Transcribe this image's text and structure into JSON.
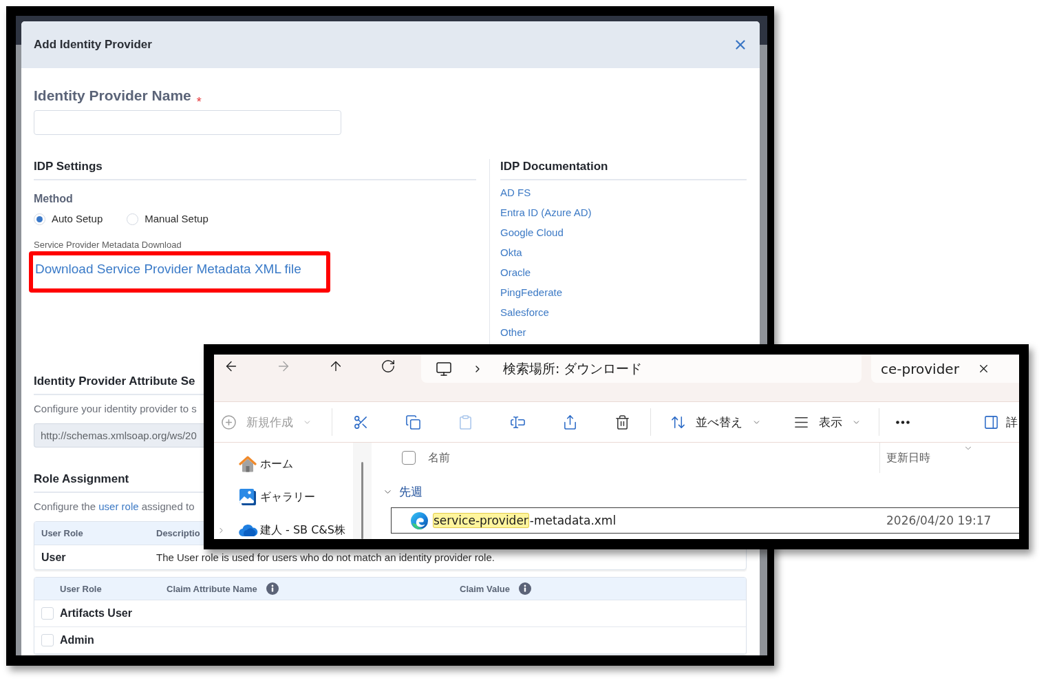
{
  "dialog": {
    "title": "Add Identity Provider"
  },
  "name_field": {
    "label": "Identity Provider Name",
    "required_mark": "*"
  },
  "idp_settings": {
    "heading": "IDP Settings",
    "method_label": "Method",
    "methods": [
      {
        "label": "Auto Setup",
        "selected": true
      },
      {
        "label": "Manual Setup",
        "selected": false
      }
    ],
    "download_label": "Service Provider Metadata Download",
    "download_link": "Download Service Provider Metadata XML file",
    "download_highlighted": true
  },
  "idp_documentation": {
    "heading": "IDP Documentation",
    "links": [
      "AD FS",
      "Entra ID (Azure AD)",
      "Google Cloud",
      "Okta",
      "Oracle",
      "PingFederate",
      "Salesforce",
      "Other"
    ]
  },
  "attribute_section": {
    "heading": "Identity Provider Attribute Se",
    "description": "Configure your identity provider to s",
    "field_value": "http://schemas.xmlsoap.org/ws/20",
    "field_disabled": true
  },
  "role_assignment": {
    "heading": "Role Assignment",
    "description": {
      "before": "Configure the ",
      "link": "user role",
      "after": " assigned to"
    },
    "default_table": {
      "columns": [
        "User Role",
        "Descriptio"
      ],
      "rows": [
        [
          "User",
          "The User role is used for users who do not match an identity provider role."
        ]
      ]
    },
    "claims_table": {
      "columns": [
        {
          "label": "User Role",
          "info": false
        },
        {
          "label": "Claim Attribute Name",
          "info": true
        },
        {
          "label": "Claim Value",
          "info": true
        }
      ],
      "rows": [
        {
          "role": "Artifacts User",
          "checked": false
        },
        {
          "role": "Admin",
          "checked": false
        }
      ]
    }
  },
  "explorer": {
    "nav_buttons": [
      {
        "kind": "back",
        "disabled": false
      },
      {
        "kind": "forward",
        "disabled": true
      },
      {
        "kind": "up",
        "disabled": false
      },
      {
        "kind": "refresh",
        "disabled": false
      }
    ],
    "address": "検索場所: ダウンロード",
    "search": {
      "value": "ce-provider"
    },
    "toolbar_groups": [
      {
        "items": [
          {
            "kind": "new",
            "label": "新規作成",
            "disabled": true,
            "menu": true
          }
        ]
      },
      {
        "items": [
          {
            "kind": "cut",
            "disabled": false
          },
          {
            "kind": "copy",
            "disabled": false
          },
          {
            "kind": "paste",
            "disabled": true
          },
          {
            "kind": "rename",
            "disabled": false
          },
          {
            "kind": "share",
            "disabled": false
          },
          {
            "kind": "delete",
            "disabled": false
          }
        ]
      },
      {
        "items": [
          {
            "kind": "sort",
            "label": "並べ替え",
            "disabled": false,
            "menu": true
          },
          {
            "kind": "view",
            "label": "表示",
            "disabled": false,
            "menu": true
          }
        ]
      },
      {
        "items": [
          {
            "kind": "more",
            "disabled": false
          },
          {
            "kind": "details",
            "label": "詳",
            "disabled": false
          }
        ]
      }
    ],
    "nav_pane": [
      {
        "kind": "home",
        "label": "ホーム"
      },
      {
        "kind": "gallery",
        "label": "ギャラリー"
      },
      {
        "kind": "cloud",
        "label": "建人 - SB C&S株",
        "expanded": false
      }
    ],
    "select_all_checked": false,
    "columns": [
      {
        "label": "名前",
        "sorted": false
      },
      {
        "label": "更新日時",
        "sorted": true
      }
    ],
    "groups": [
      {
        "label": "先週",
        "expanded": true,
        "files": [
          {
            "name": [
              {
                "text": "service-provider",
                "highlighted": true
              },
              {
                "text": "-metadata.xml",
                "highlighted": false
              }
            ],
            "modified": "2026/04/20 19:17",
            "focused": true
          }
        ]
      }
    ]
  }
}
